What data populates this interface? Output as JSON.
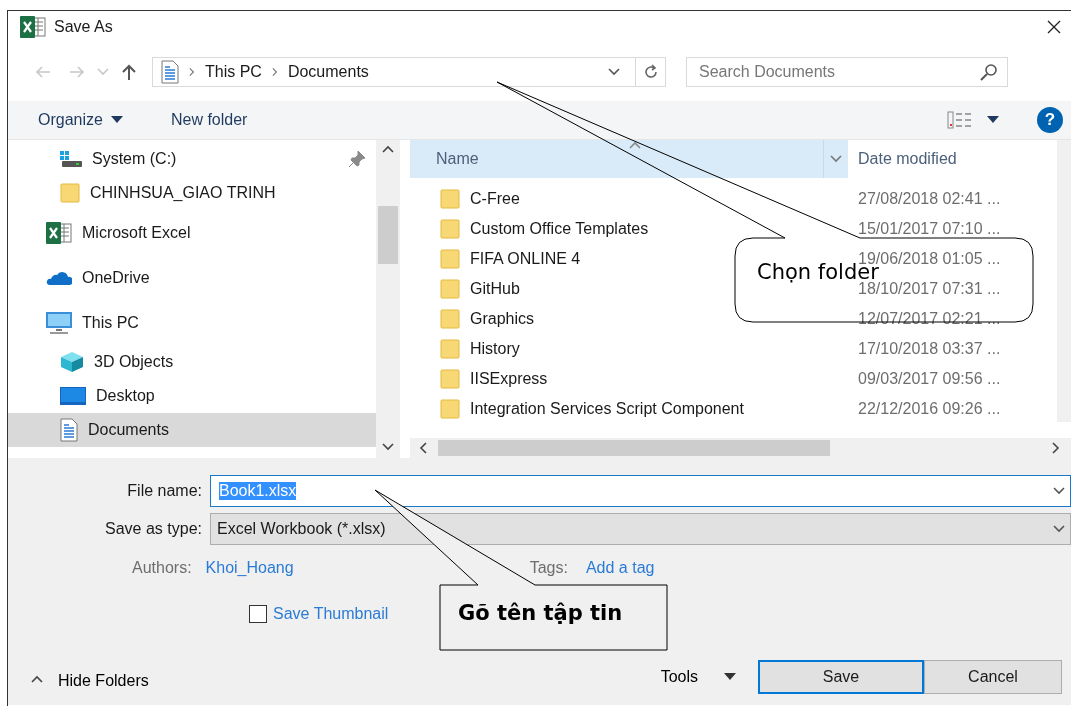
{
  "window": {
    "title": "Save As"
  },
  "address": {
    "path": [
      {
        "label": "This PC"
      },
      {
        "label": "Documents"
      }
    ]
  },
  "search": {
    "placeholder": "Search Documents"
  },
  "toolbar": {
    "organize": "Organize",
    "new_folder": "New folder",
    "help": "?"
  },
  "sidebar": {
    "pinned_items": [
      {
        "label": "System (C:)",
        "kind": "drive",
        "pinned": true,
        "selected": false
      },
      {
        "label": "CHINHSUA_GIAO TRINH",
        "kind": "folder",
        "pinned": false,
        "selected": false
      }
    ],
    "items": [
      {
        "label": "Microsoft Excel",
        "kind": "excel",
        "selected": false
      },
      {
        "label": "OneDrive",
        "kind": "cloud",
        "selected": false
      },
      {
        "label": "This PC",
        "kind": "computer",
        "selected": false,
        "children": [
          {
            "label": "3D Objects",
            "kind": "objects",
            "selected": false
          },
          {
            "label": "Desktop",
            "kind": "desktop",
            "selected": false
          },
          {
            "label": "Documents",
            "kind": "documents",
            "selected": true
          }
        ]
      }
    ]
  },
  "files": {
    "columns": [
      {
        "label": "Name",
        "sorted": true
      },
      {
        "label": "Date modified",
        "sorted": false
      }
    ],
    "rows": [
      {
        "name": "C-Free",
        "date": "27/08/2018 02:41 ..."
      },
      {
        "name": "Custom Office Templates",
        "date": "15/01/2017 07:10 ..."
      },
      {
        "name": "FIFA ONLINE 4",
        "date": "19/06/2018 01:05 ..."
      },
      {
        "name": "GitHub",
        "date": "18/10/2017 07:31 ..."
      },
      {
        "name": "Graphics",
        "date": "12/07/2017 02:21 ..."
      },
      {
        "name": "History",
        "date": "17/10/2018 03:37 ..."
      },
      {
        "name": "IISExpress",
        "date": "09/03/2017 09:56 ..."
      },
      {
        "name": "Integration Services Script Component",
        "date": "22/12/2016 09:26 ..."
      }
    ]
  },
  "form": {
    "file_name": {
      "label": "File name:",
      "value": "Book1.xlsx",
      "text_selected": true
    },
    "save_as_type": {
      "label": "Save as type:",
      "value": "Excel Workbook (*.xlsx)"
    },
    "authors": {
      "label": "Authors:",
      "value": "Khoi_Hoang"
    },
    "tags": {
      "label": "Tags:",
      "value": "Add a tag"
    },
    "save_thumbnail": {
      "label": "Save Thumbnail",
      "checked": false
    }
  },
  "footer": {
    "hide_folders": "Hide Folders",
    "tools": "Tools",
    "buttons": [
      {
        "label": "Save",
        "default": true
      },
      {
        "label": "Cancel",
        "default": false
      }
    ]
  },
  "callouts": [
    {
      "text": "Chọn folder",
      "kind": "rounded"
    },
    {
      "text": "Gõ tên tập tin",
      "kind": "rect"
    }
  ]
}
